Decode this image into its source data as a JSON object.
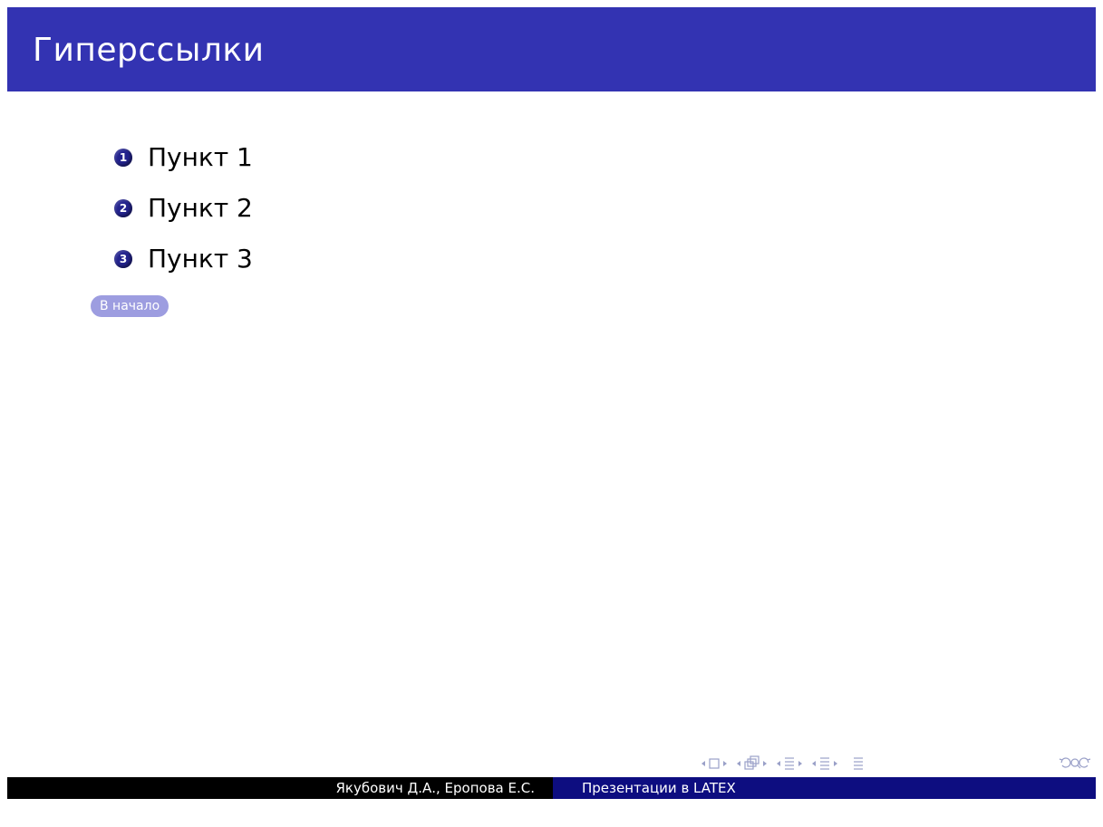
{
  "slide": {
    "title": "Гиперссылки",
    "items": [
      {
        "number": "1",
        "label": "Пункт 1"
      },
      {
        "number": "2",
        "label": "Пункт 2"
      },
      {
        "number": "3",
        "label": "Пункт 3"
      }
    ],
    "button_label": "В начало"
  },
  "footer": {
    "authors": "Якубович Д.А., Еропова Е.С.",
    "presentation_title": "Презентации в LATEX"
  },
  "nav_icons": [
    "nav-frame-back-icon",
    "nav-frame-icon",
    "nav-frame-forward-icon",
    "nav-subsection-back-icon",
    "nav-subsection-icon",
    "nav-subsection-forward-icon",
    "nav-section-back-icon",
    "nav-section-icon",
    "nav-section-forward-icon",
    "nav-presentation-back-icon",
    "nav-presentation-icon",
    "nav-presentation-forward-icon",
    "nav-appendix-icon",
    "nav-undo-icon",
    "nav-search-icon",
    "nav-redo-icon"
  ],
  "colors": {
    "titlebar": "#3333b2",
    "number_ball": "#23238e",
    "button": "#9d9de0",
    "footer_left": "#000000",
    "footer_right": "#0d0d80"
  }
}
